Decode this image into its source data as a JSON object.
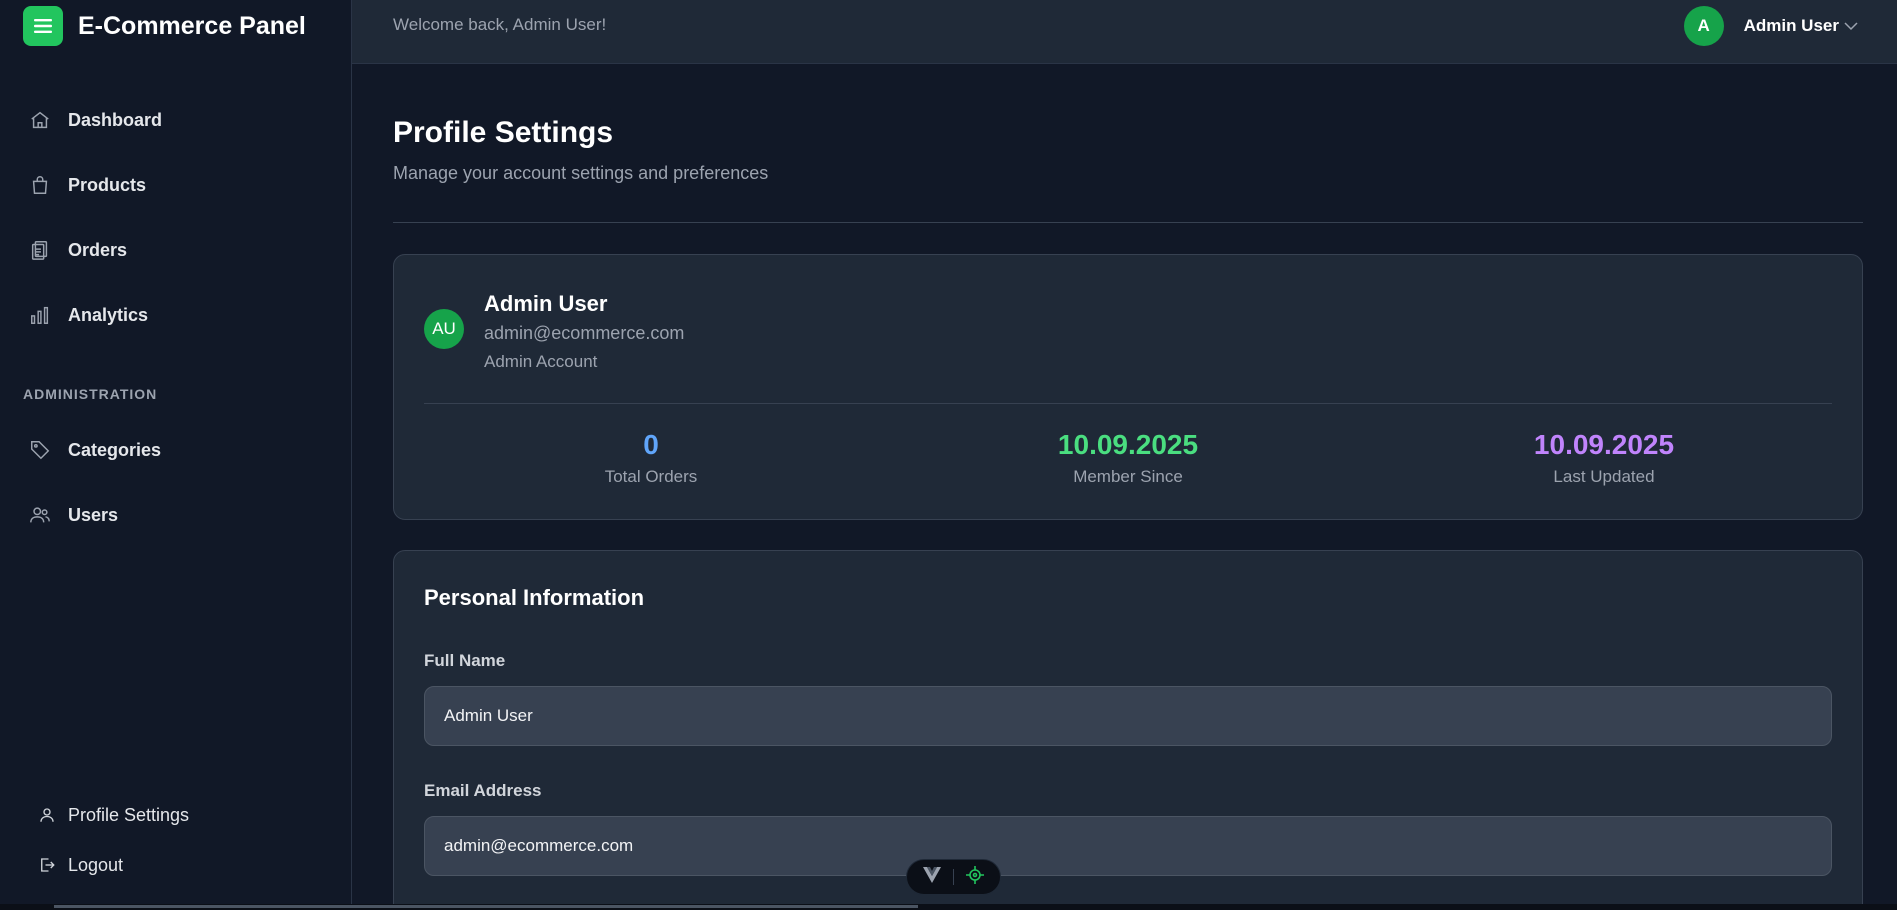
{
  "brand": {
    "title": "E-Commerce Panel",
    "icon": "menu-icon",
    "color": "#22c55e"
  },
  "sidebar": {
    "items": [
      {
        "label": "Dashboard",
        "icon": "home-icon"
      },
      {
        "label": "Products",
        "icon": "shopping-bag-icon"
      },
      {
        "label": "Orders",
        "icon": "clipboard-icon"
      },
      {
        "label": "Analytics",
        "icon": "bar-chart-icon"
      }
    ],
    "admin_section": "ADMINISTRATION",
    "admin_items": [
      {
        "label": "Categories",
        "icon": "tag-icon"
      },
      {
        "label": "Users",
        "icon": "users-icon"
      }
    ],
    "bottom_items": [
      {
        "label": "Profile Settings",
        "icon": "user-icon"
      },
      {
        "label": "Logout",
        "icon": "logout-icon"
      }
    ]
  },
  "header": {
    "welcome": "Welcome back, Admin User!",
    "avatar_initial": "A",
    "user_name": "Admin User"
  },
  "page": {
    "title": "Profile Settings",
    "subtitle": "Manage your account settings and preferences"
  },
  "profile": {
    "initials": "AU",
    "name": "Admin User",
    "email": "admin@ecommerce.com",
    "role": "Admin Account",
    "stats": [
      {
        "value": "0",
        "label": "Total Orders",
        "color": "#60a5fa"
      },
      {
        "value": "10.09.2025",
        "label": "Member Since",
        "color": "#4ade80"
      },
      {
        "value": "10.09.2025",
        "label": "Last Updated",
        "color": "#c084fc"
      }
    ]
  },
  "personal_info": {
    "title": "Personal Information",
    "full_name_label": "Full Name",
    "full_name_value": "Admin User",
    "email_label": "Email Address",
    "email_value": "admin@ecommerce.com"
  },
  "colors": {
    "accent": "#22c55e",
    "background": "#111827",
    "card": "#1f2937"
  }
}
